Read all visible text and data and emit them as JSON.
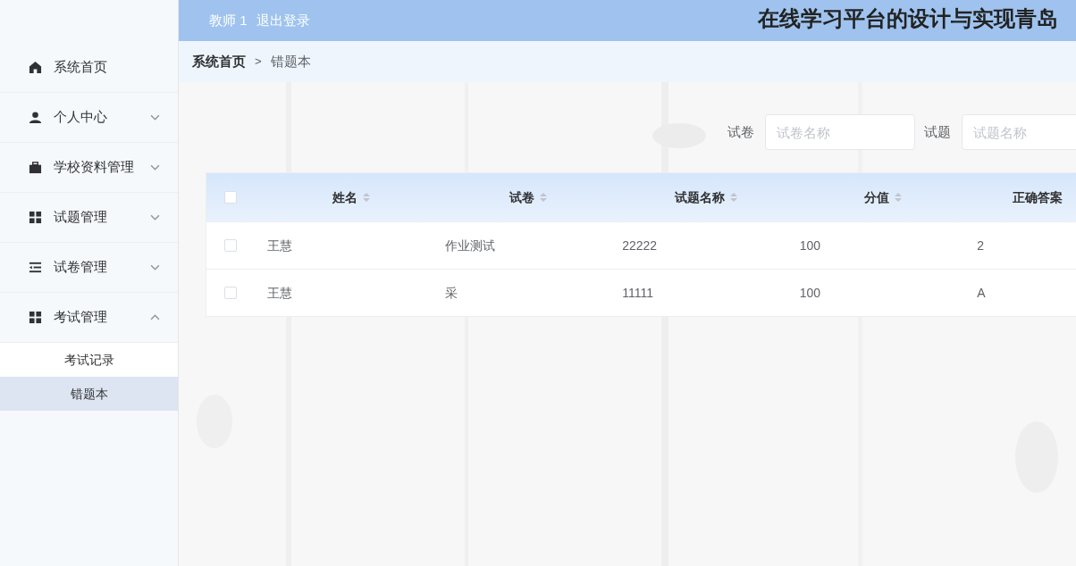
{
  "header": {
    "user": "教师 1",
    "logout": "退出登录",
    "title": "在线学习平台的设计与实现青岛"
  },
  "sidebar": {
    "items": [
      {
        "label": "系统首页"
      },
      {
        "label": "个人中心",
        "expanded": false
      },
      {
        "label": "学校资料管理",
        "expanded": false
      },
      {
        "label": "试题管理",
        "expanded": false
      },
      {
        "label": "试卷管理",
        "expanded": false
      },
      {
        "label": "考试管理",
        "expanded": true,
        "children": [
          {
            "label": "考试记录",
            "selected": false
          },
          {
            "label": "错题本",
            "selected": true
          }
        ]
      }
    ]
  },
  "breadcrumb": [
    "系统首页",
    "错题本"
  ],
  "breadcrumb_separator": ">",
  "search": [
    {
      "label": "试卷",
      "placeholder": "试卷名称"
    },
    {
      "label": "试题",
      "placeholder": "试题名称"
    }
  ],
  "table": {
    "select_all_checked": false,
    "columns": [
      "姓名",
      "试卷",
      "试题名称",
      "分值",
      "正确答案"
    ],
    "rows": [
      {
        "checked": false,
        "cells": [
          "王慧",
          "作业测试",
          "22222",
          "100",
          "2"
        ]
      },
      {
        "checked": false,
        "cells": [
          "王慧",
          "采",
          "11111",
          "100",
          "A"
        ]
      }
    ]
  }
}
